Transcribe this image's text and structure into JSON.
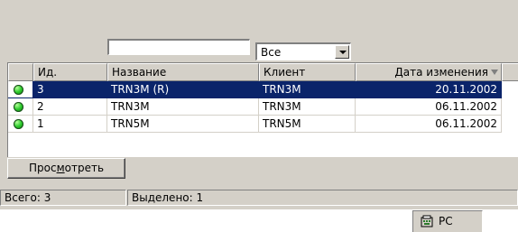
{
  "filter": {
    "text_value": "",
    "select_value": "Все"
  },
  "grid": {
    "columns": [
      "Ид.",
      "Название",
      "Клиент",
      "Дата изменения"
    ],
    "rows": [
      {
        "id": "3",
        "name": "TRN3M (R)",
        "client": "TRN3M",
        "date": "20.11.2002",
        "selected": true
      },
      {
        "id": "2",
        "name": "TRN3M",
        "client": "TRN3M",
        "date": "06.11.2002",
        "selected": false
      },
      {
        "id": "1",
        "name": "TRN5M",
        "client": "TRN5M",
        "date": "06.11.2002",
        "selected": false
      }
    ],
    "status_icon": "green-dot-icon"
  },
  "buttons": {
    "view_pre": "Прос",
    "view_mnemonic": "м",
    "view_post": "отреть"
  },
  "status": {
    "total": "Всего: 3",
    "selected": "Выделено: 1"
  },
  "tray": {
    "language": "PC",
    "icon": "keyboard-icon"
  },
  "colors": {
    "selection": "#0a246a",
    "face": "#d4d0c8"
  }
}
